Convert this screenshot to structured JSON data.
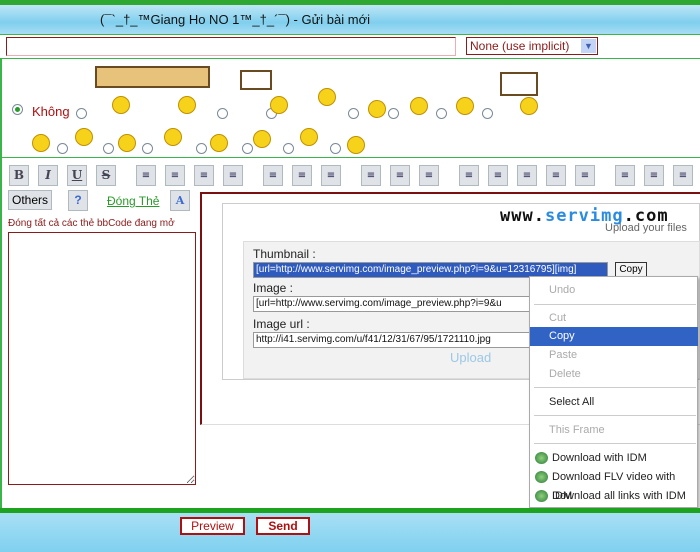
{
  "header": {
    "title": "(¯`_†_™Giang Ho NO 1™_†_´¯) - Gửi bài mới"
  },
  "subject": {
    "value": ""
  },
  "icon_select": {
    "selected": "None (use implicit)"
  },
  "smilies": {
    "none_label": "Không"
  },
  "toolbar": {
    "buttons": [
      "bold",
      "italic",
      "underline",
      "strike",
      "align-left",
      "align-center",
      "align-right",
      "justify",
      "bullet-list",
      "number-list",
      "hr",
      "quote",
      "code",
      "table",
      "image-upload",
      "image",
      "link",
      "flash",
      "video",
      "font",
      "color",
      "font-face"
    ],
    "bold": "B",
    "italic": "I",
    "underline": "U",
    "strike": "S",
    "others": "Others",
    "close_tags": "Đóng Thẻ",
    "close_all": "Đóng tất cả các thẻ bbCode đang mở"
  },
  "servimg": {
    "logo_a": "www.",
    "logo_b": "servimg",
    "logo_c": ".com",
    "tagline": "Upload your files",
    "thumbnail_label": "Thumbnail :",
    "thumbnail_value": "[url=http://www.servimg.com/image_preview.php?i=9&u=12316795][img]",
    "image_label": "Image :",
    "image_value": "[url=http://www.servimg.com/image_preview.php?i=9&u",
    "url_label": "Image url :",
    "url_value": "http://i41.servimg.com/u/f41/12/31/67/95/1721110.jpg",
    "copy": "Copy",
    "upload": "Upload"
  },
  "context_menu": {
    "undo": "Undo",
    "cut": "Cut",
    "copy": "Copy",
    "paste": "Paste",
    "delete": "Delete",
    "select_all": "Select All",
    "this_frame": "This Frame",
    "idm1": "Download with IDM",
    "idm2": "Download FLV video with IDM",
    "idm3": "Download all links with IDM"
  },
  "footer": {
    "preview": "Preview",
    "send": "Send"
  },
  "colors": {
    "green": "#3ab54a",
    "dark_red": "#8b1a1a",
    "highlight": "#3163c4"
  }
}
